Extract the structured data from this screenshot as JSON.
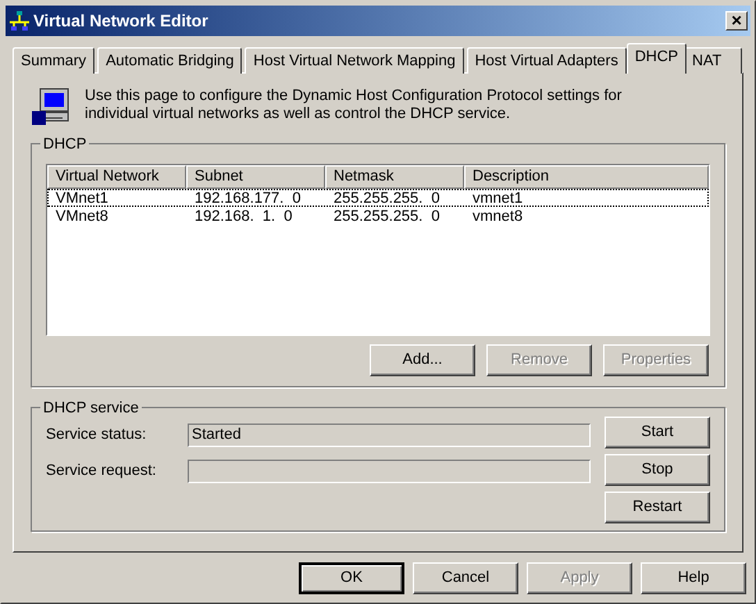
{
  "window": {
    "title": "Virtual Network Editor",
    "close": "×"
  },
  "tabs": [
    {
      "label": "Summary",
      "selected": false
    },
    {
      "label": "Automatic Bridging",
      "selected": false
    },
    {
      "label": "Host Virtual Network Mapping",
      "selected": false
    },
    {
      "label": "Host Virtual Adapters",
      "selected": false
    },
    {
      "label": "DHCP",
      "selected": true
    },
    {
      "label": "NAT",
      "selected": false
    }
  ],
  "intro": "Use this page to configure the Dynamic Host Configuration Protocol settings for individual virtual networks as well as control the DHCP service.",
  "dhcp_group": {
    "title": "DHCP",
    "table": {
      "columns": [
        "Virtual Network",
        "Subnet",
        "Netmask",
        "Description"
      ],
      "rows": [
        {
          "cells": [
            "VMnet1",
            "192.168.177.  0",
            "255.255.255.  0",
            "vmnet1"
          ],
          "focused": true
        },
        {
          "cells": [
            "VMnet8",
            "192.168.  1.  0",
            "255.255.255.  0",
            "vmnet8"
          ],
          "focused": false
        }
      ]
    },
    "buttons": [
      {
        "label": "Add...",
        "disabled": false
      },
      {
        "label": "Remove",
        "disabled": true
      },
      {
        "label": "Properties",
        "disabled": true
      }
    ]
  },
  "service_group": {
    "title": "DHCP service",
    "fields": [
      {
        "label": "Service status:",
        "value": "Started"
      },
      {
        "label": "Service request:"
      }
    ],
    "buttons": [
      {
        "label": "Start",
        "disabled": false
      },
      {
        "label": "Stop",
        "disabled": false
      },
      {
        "label": "Restart",
        "disabled": false
      }
    ]
  },
  "buttons": [
    {
      "label": "OK",
      "disabled": false,
      "default": true
    },
    {
      "label": "Cancel",
      "disabled": false,
      "default": false
    },
    {
      "label": "Apply",
      "disabled": true,
      "default": false
    },
    {
      "label": "Help",
      "disabled": false,
      "default": false
    }
  ]
}
